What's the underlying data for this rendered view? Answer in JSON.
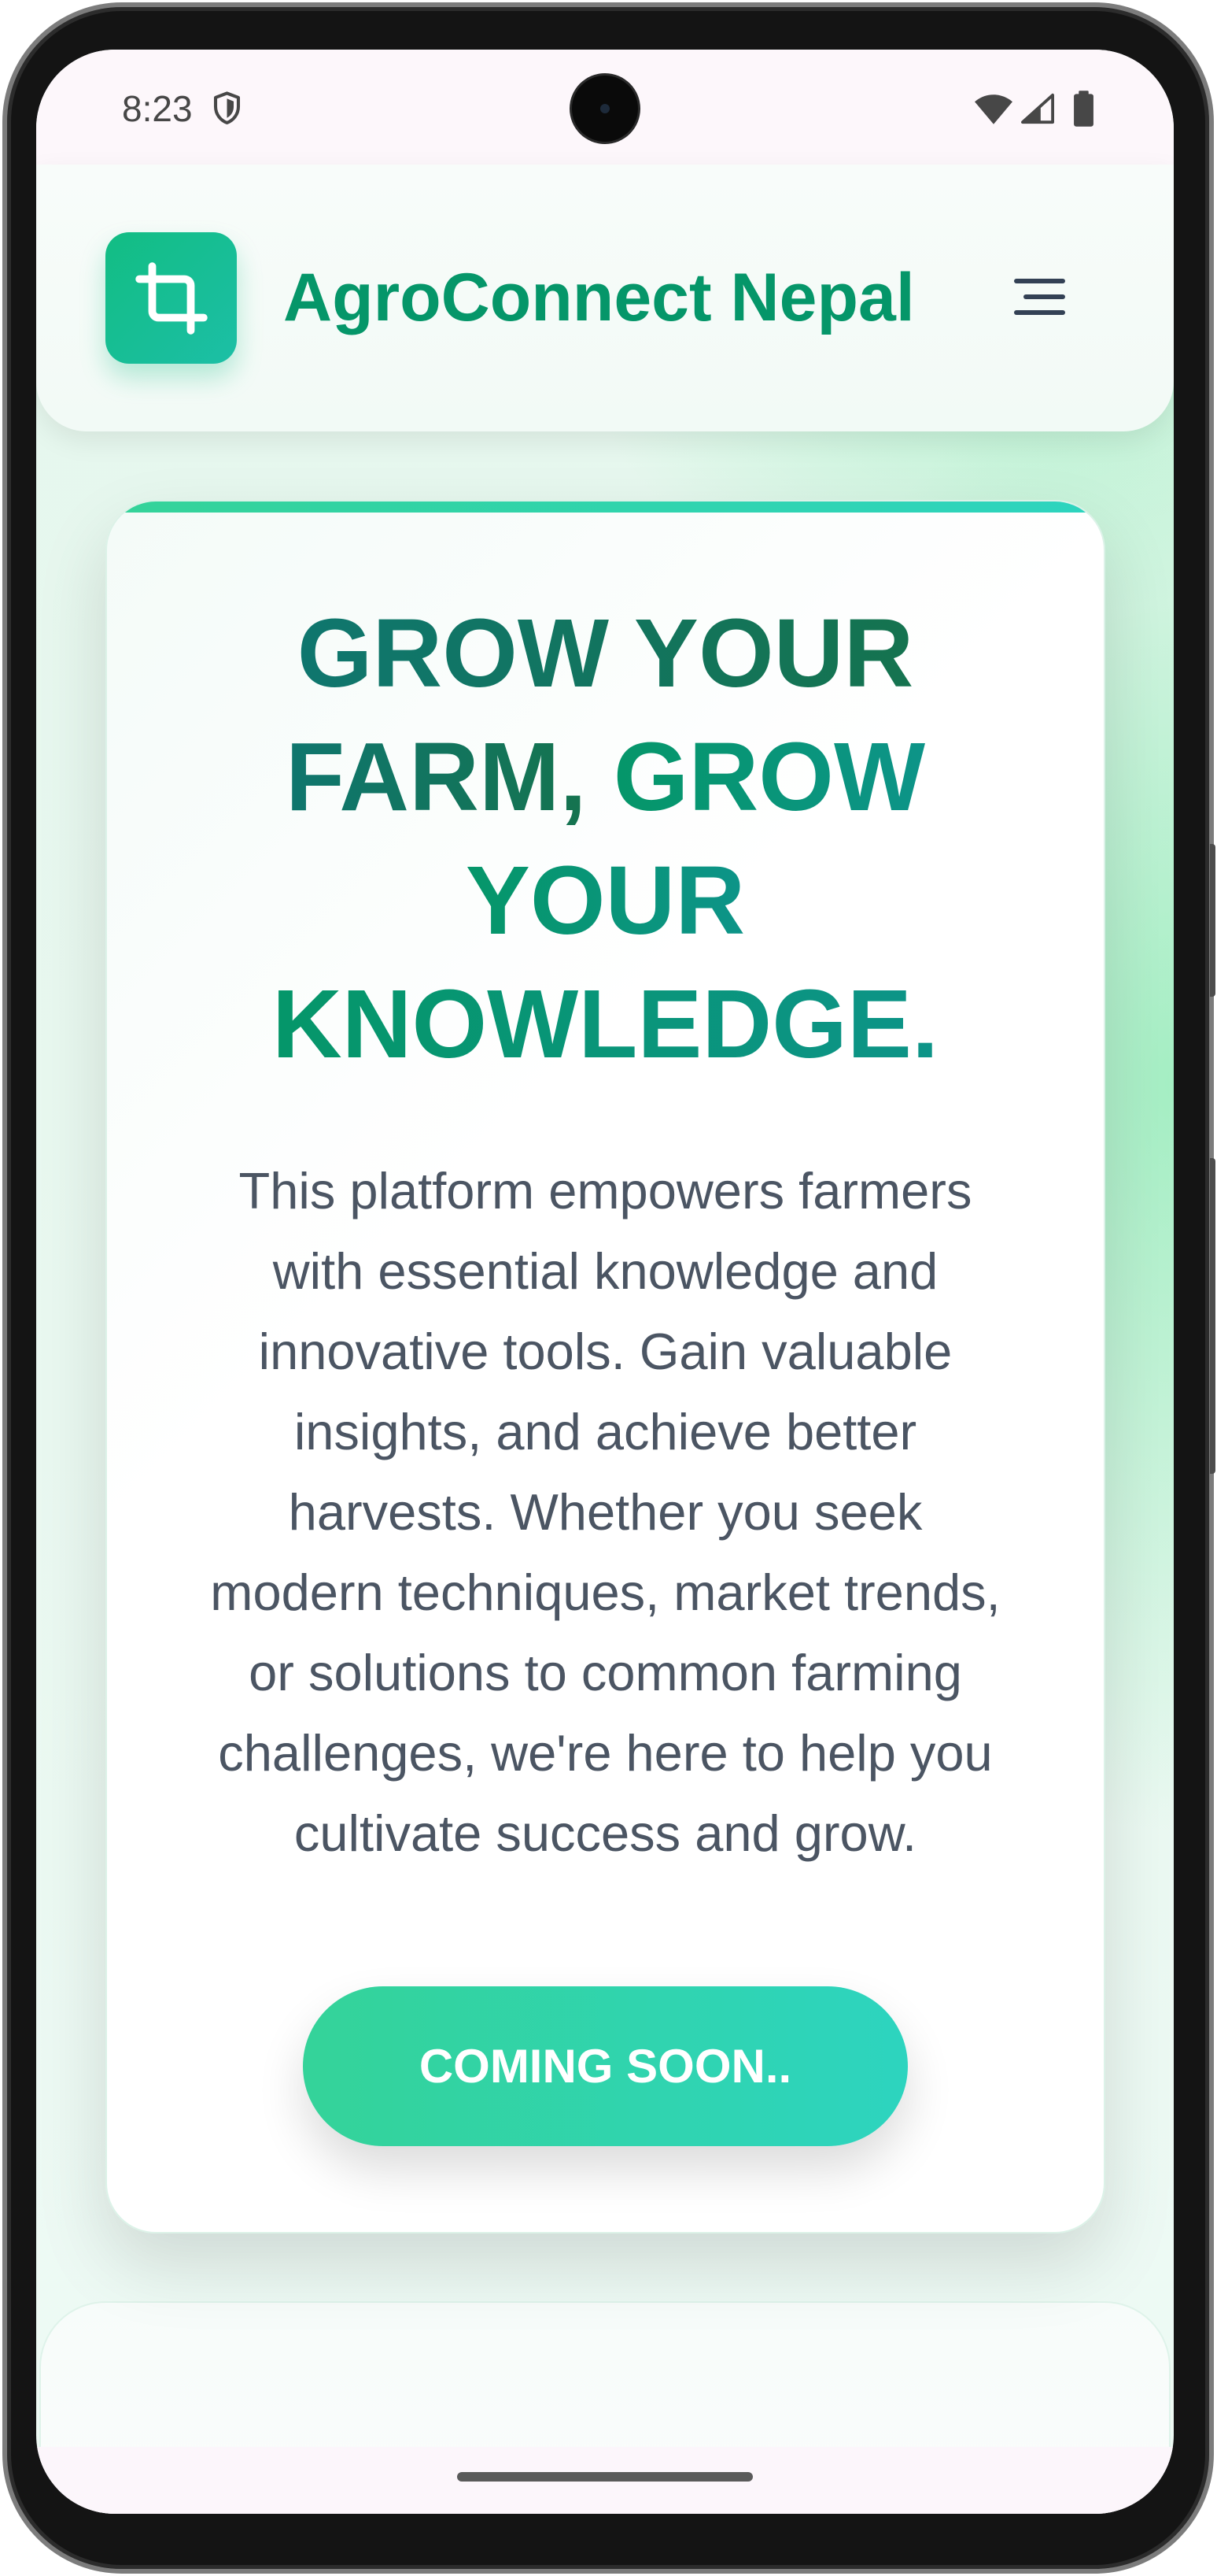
{
  "status_bar": {
    "time": "8:23",
    "icons": [
      "shield-icon",
      "wifi-icon",
      "cellular-signal-icon",
      "battery-icon"
    ]
  },
  "header": {
    "app_name": "AgroConnect Nepal",
    "logo_icon": "crop-icon",
    "menu_icon": "menu-icon"
  },
  "hero": {
    "headline_lead": "GROW YOUR FARM,",
    "headline_highlight": "GROW YOUR KNOWLEDGE.",
    "description": "This platform empowers farmers with essential knowledge and innovative tools. Gain valuable insights, and achieve better harvests. Whether you seek modern techniques, market trends, or solutions to common farming challenges, we're here to help you cultivate success and grow.",
    "cta_label": "COMING SOON.."
  },
  "colors": {
    "brand_green": "#059669",
    "accent_gradient_start": "#34d399",
    "accent_gradient_end": "#2dd4bf",
    "headline_dark": "#0f766e",
    "body_text": "#4b5563",
    "page_background": "#e9f8f0"
  }
}
